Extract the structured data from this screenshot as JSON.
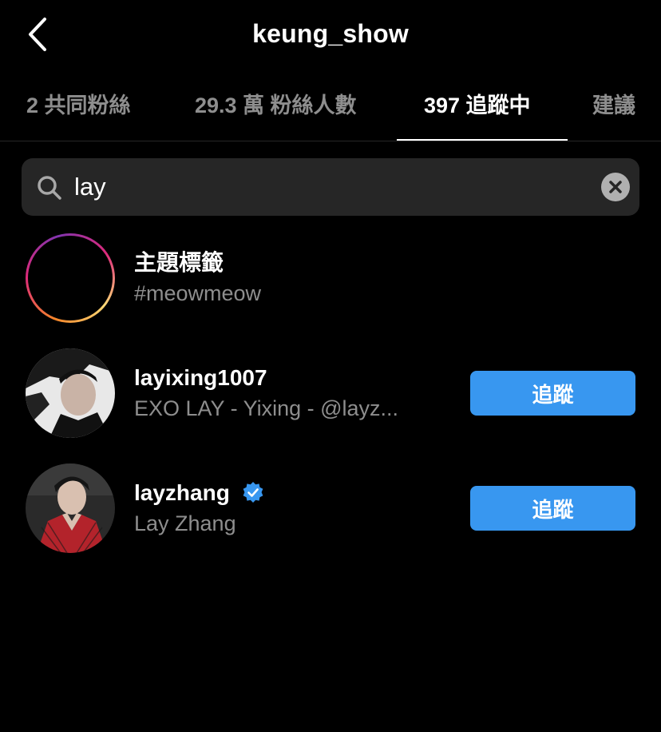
{
  "header": {
    "title": "keung_show"
  },
  "tabs": [
    {
      "label": "2 共同粉絲",
      "active": false
    },
    {
      "label": "29.3 萬 粉絲人數",
      "active": false
    },
    {
      "label": "397 追蹤中",
      "active": true
    },
    {
      "label": "建議",
      "active": false
    }
  ],
  "search": {
    "value": "lay",
    "icon": "search-icon",
    "clear_icon": "clear-icon"
  },
  "results": [
    {
      "type": "hashtag",
      "title": "主題標籤",
      "subtitle": "#meowmeow",
      "icon": "hashtag-icon"
    },
    {
      "type": "user",
      "title": "layixing1007",
      "subtitle": "EXO LAY - Yixing - @layz...",
      "verified": false,
      "button": "追蹤"
    },
    {
      "type": "user",
      "title": "layzhang",
      "subtitle": "Lay Zhang",
      "verified": true,
      "button": "追蹤"
    }
  ],
  "colors": {
    "background": "#000000",
    "primary_text": "#ffffff",
    "secondary_text": "#8e8e8e",
    "search_bg": "#262626",
    "follow_button": "#3897f0",
    "verified_badge": "#3897f0"
  }
}
